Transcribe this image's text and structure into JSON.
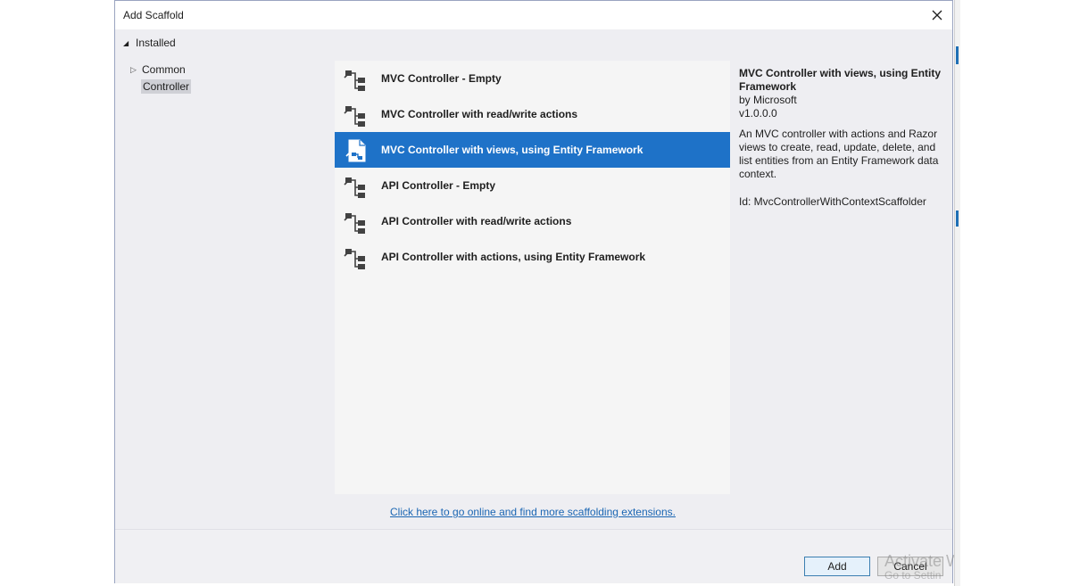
{
  "dialog": {
    "title": "Add Scaffold"
  },
  "tree": {
    "root_label": "Installed",
    "items": [
      {
        "label": "Common",
        "expanded": false
      },
      {
        "label": "Controller",
        "selected": true
      }
    ]
  },
  "scaffolds": [
    {
      "label": "MVC Controller - Empty",
      "icon": "controller-icon"
    },
    {
      "label": "MVC Controller with read/write actions",
      "icon": "controller-icon"
    },
    {
      "label": "MVC Controller with views, using Entity Framework",
      "icon": "document-controller-icon",
      "selected": true
    },
    {
      "label": "API Controller - Empty",
      "icon": "controller-icon"
    },
    {
      "label": "API Controller with read/write actions",
      "icon": "controller-icon"
    },
    {
      "label": "API Controller with actions, using Entity Framework",
      "icon": "controller-icon"
    }
  ],
  "details": {
    "title": "MVC Controller with views, using Entity Framework",
    "author": "by Microsoft",
    "version": "v1.0.0.0",
    "description": "An MVC controller with actions and Razor views to create, read, update, delete, and list entities from an Entity Framework data context.",
    "id": "Id: MvcControllerWithContextScaffolder"
  },
  "online_link": "Click here to go online and find more scaffolding extensions.",
  "buttons": {
    "add": "Add",
    "cancel": "Cancel"
  },
  "watermark": {
    "line1": "Activate W",
    "line2": "Go to Settin"
  },
  "colors": {
    "selection": "#1e72c8",
    "link": "#1b66b3",
    "dialog_background": "#eeeef2"
  }
}
